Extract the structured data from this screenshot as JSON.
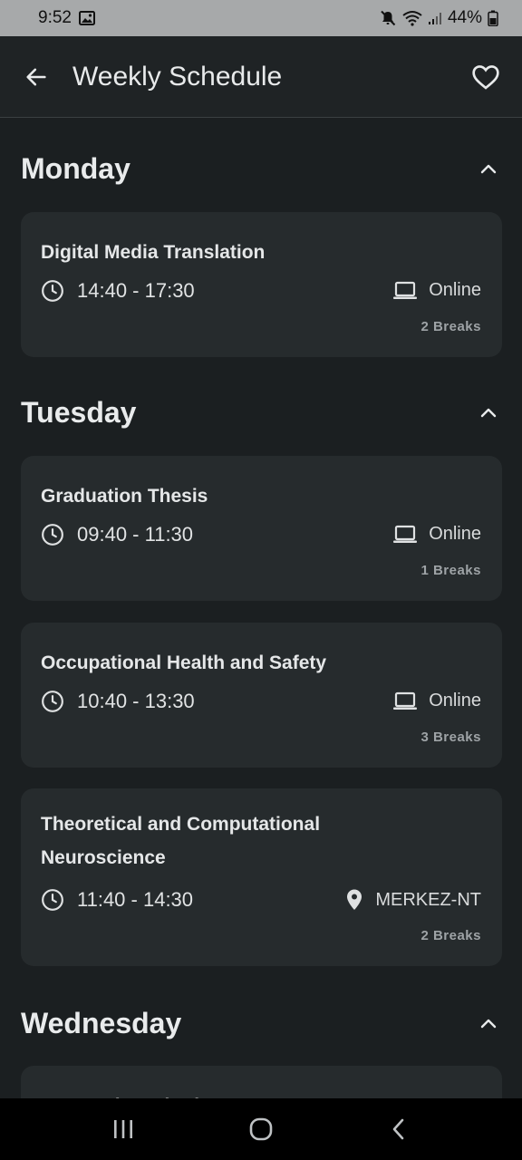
{
  "status_bar": {
    "time": "9:52",
    "battery": "44%"
  },
  "app_bar": {
    "title": "Weekly Schedule"
  },
  "days": [
    {
      "name": "Monday",
      "classes": [
        {
          "course": "Digital Media Translation",
          "time": "14:40 - 17:30",
          "location": "Online",
          "location_icon": "laptop-icon",
          "breaks": "2 Breaks"
        }
      ]
    },
    {
      "name": "Tuesday",
      "classes": [
        {
          "course": "Graduation Thesis",
          "time": "09:40 - 11:30",
          "location": "Online",
          "location_icon": "laptop-icon",
          "breaks": "1 Breaks"
        },
        {
          "course": "Occupational Health and Safety",
          "time": "10:40 - 13:30",
          "location": "Online",
          "location_icon": "laptop-icon",
          "breaks": "3 Breaks"
        },
        {
          "course": "Theoretical and Computational Neuroscience",
          "time": "11:40 - 14:30",
          "location": "MERKEZ-NT",
          "location_icon": "location-pin-icon",
          "breaks": "2 Breaks"
        }
      ]
    },
    {
      "name": "Wednesday",
      "classes": [
        {
          "course": "Research Methods"
        }
      ]
    }
  ],
  "colors": {
    "background": "#1b1f21",
    "card": "#262b2d",
    "status_bar": "#a7a9aa",
    "text": "#e6e8e9",
    "muted": "#9ea3a6"
  }
}
